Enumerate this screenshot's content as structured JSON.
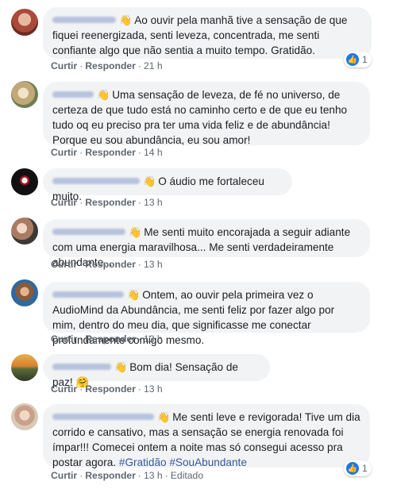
{
  "actions": {
    "like": "Curtir",
    "reply": "Responder",
    "dot": "·",
    "edited": "Editado"
  },
  "comments": [
    {
      "text": "Ao ouvir pela manhã tive a sensação de que fiquei reenergizada, senti leveza, concentrada, me senti confiante algo que não sentia a muito tempo. Gratidão.",
      "time": "21 h",
      "reactions": "1"
    },
    {
      "text": "Uma sensação de leveza, de fé no universo, de certeza de que tudo está no caminho certo e de que eu tenho tudo oq eu preciso pra ter uma vida feliz e de abundância! Porque eu sou abundância, eu sou amor!",
      "time": "14 h"
    },
    {
      "text": "O áudio me fortaleceu muito.",
      "time": "13 h"
    },
    {
      "text": "Me senti muito encorajada a seguir adiante com uma energia maravilhosa... Me senti verdadeiramente abundante...",
      "time": "13 h"
    },
    {
      "text": "Ontem, ao ouvir pela primeira vez o AudioMind da Abundância, me senti feliz por fazer algo por mim, dentro do meu dia, que significasse me conectar profundamente comigo mesmo.",
      "time": "13 h"
    },
    {
      "text": "Bom dia! Sensação de paz! 🤗",
      "time": "13 h"
    },
    {
      "text": "Me senti leve e revigorada! Tive um dia corrido e cansativo, mas a sensação se energia renovada foi ímpar!!! Comecei ontem a noite mas só consegui acesso pra postar agora.",
      "hashtags": "#Gratidão #SouAbundante",
      "time": "13 h",
      "reactions": "1"
    }
  ],
  "icons": {
    "wave": "👋",
    "like": "👍"
  }
}
